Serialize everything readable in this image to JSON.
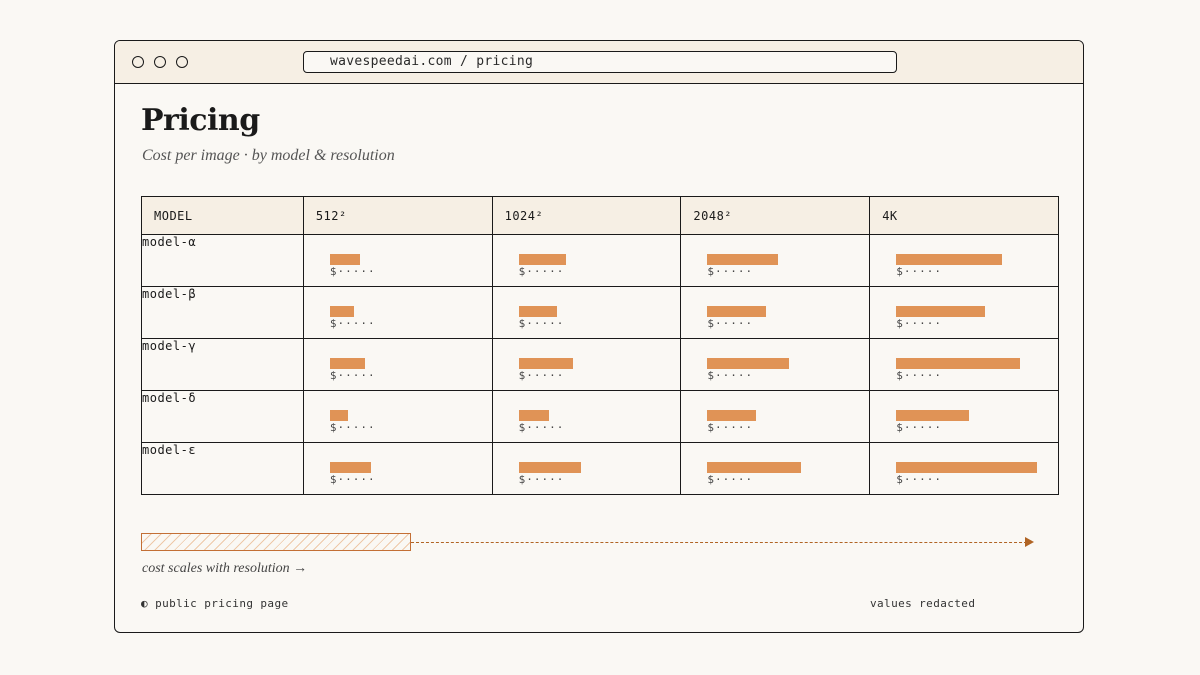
{
  "browser": {
    "url": "wavespeedai.com / pricing"
  },
  "page": {
    "title": "Pricing",
    "subtitle": "Cost per image · by model & resolution"
  },
  "table": {
    "columns": [
      "MODEL",
      "512²",
      "1024²",
      "2048²",
      "4K"
    ],
    "rows": [
      {
        "model": "model-α",
        "prices": [
          "$·····",
          "$·····",
          "$·····",
          "$·····"
        ],
        "bar_fraction": [
          0.21,
          0.33,
          0.5,
          0.75
        ]
      },
      {
        "model": "model-β",
        "prices": [
          "$·····",
          "$·····",
          "$·····",
          "$·····"
        ],
        "bar_fraction": [
          0.17,
          0.27,
          0.42,
          0.63
        ]
      },
      {
        "model": "model-γ",
        "prices": [
          "$·····",
          "$·····",
          "$·····",
          "$·····"
        ],
        "bar_fraction": [
          0.25,
          0.38,
          0.58,
          0.88
        ]
      },
      {
        "model": "model-δ",
        "prices": [
          "$·····",
          "$·····",
          "$·····",
          "$·····"
        ],
        "bar_fraction": [
          0.13,
          0.21,
          0.35,
          0.52
        ]
      },
      {
        "model": "model-ε",
        "prices": [
          "$·····",
          "$·····",
          "$·····",
          "$·····"
        ],
        "bar_fraction": [
          0.29,
          0.44,
          0.67,
          1.0
        ]
      }
    ]
  },
  "scale": {
    "caption": "cost scales with resolution →"
  },
  "footer": {
    "left_icon": "half-circle-icon",
    "left_icon_glyph": "◐",
    "left": "public pricing page",
    "right": "values redacted"
  },
  "colors": {
    "bar": "#e09356",
    "accent_line": "#b06424",
    "header_bg": "#f6efe4",
    "page_bg": "#faf8f4"
  }
}
